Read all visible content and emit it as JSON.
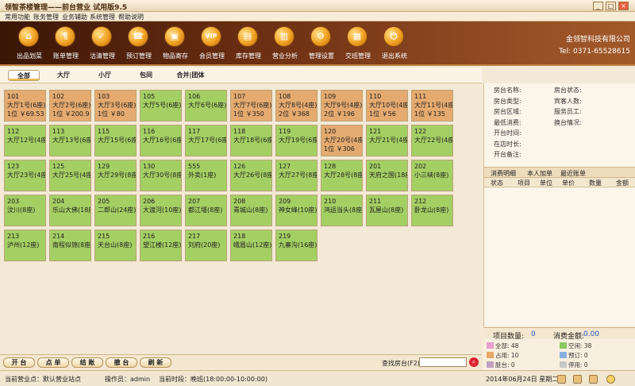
{
  "window": {
    "title": "领智茶楼管理——前台营业 试用版9.5",
    "min": "_",
    "max": "□",
    "close": "×"
  },
  "menu": [
    "常用功能",
    "账务管理",
    "业务辅助",
    "系统管理",
    "帮助说明"
  ],
  "toolbar": [
    {
      "label": "出品划菜",
      "icon": "dish-icon",
      "glyph": "⌂"
    },
    {
      "label": "账单管理",
      "icon": "bill-icon",
      "glyph": "¶"
    },
    {
      "label": "沽清管理",
      "icon": "clear-icon",
      "glyph": "✓"
    },
    {
      "label": "预订管理",
      "icon": "phone-icon",
      "glyph": "☎"
    },
    {
      "label": "物品寄存",
      "icon": "storage-icon",
      "glyph": "▣"
    },
    {
      "label": "会员管理",
      "icon": "vip-icon",
      "glyph": "VIP"
    },
    {
      "label": "库存管理",
      "icon": "folder-icon",
      "glyph": "▤"
    },
    {
      "label": "营业分析",
      "icon": "chart-icon",
      "glyph": "▥"
    },
    {
      "label": "管理设置",
      "icon": "gear-icon",
      "glyph": "⚙"
    },
    {
      "label": "交班管理",
      "icon": "handover-icon",
      "glyph": "▦"
    },
    {
      "label": "退出系统",
      "icon": "power-icon",
      "glyph": "⏻"
    }
  ],
  "company": {
    "name": "金领智科技有限公司",
    "tel": "Tel: 0371-65528615"
  },
  "area_tabs": [
    "全部",
    "大厅",
    "小厅",
    "包间",
    "合并|团体"
  ],
  "rooms": [
    [
      "101",
      "大厅1号(6座)",
      "1位 ￥69.53",
      "busy"
    ],
    [
      "102",
      "大厅2号(6座)",
      "1位 ￥200.9",
      "busy"
    ],
    [
      "103",
      "大厅3号(6座)",
      "1位 ￥80",
      "busy"
    ],
    [
      "105",
      "大厅5号(6座)",
      "",
      "free"
    ],
    [
      "106",
      "大厅6号(6座)",
      "",
      "free"
    ],
    [
      "107",
      "大厅7号(6座)",
      "1位 ￥350",
      "busy"
    ],
    [
      "108",
      "大厅8号(4座)",
      "2位 ￥368",
      "busy"
    ],
    [
      "109",
      "大厅9号(4座)",
      "2位 ￥196",
      "busy"
    ],
    [
      "110",
      "大厅10号(4座)",
      "1位 ￥56",
      "busy"
    ],
    [
      "111",
      "大厅11号(4座)",
      "1位 ￥135",
      "busy"
    ],
    [
      "112",
      "大厅12号(4座)",
      "",
      "free"
    ],
    [
      "113",
      "大厅13号(6座)",
      "",
      "free"
    ],
    [
      "115",
      "大厅15号(6座)",
      "",
      "free"
    ],
    [
      "116",
      "大厅16号(6座)",
      "",
      "free"
    ],
    [
      "117",
      "大厅17号(6座)",
      "",
      "free"
    ],
    [
      "118",
      "大厅18号(6座)",
      "",
      "free"
    ],
    [
      "119",
      "大厅19号(6座)",
      "",
      "free"
    ],
    [
      "120",
      "大厅20号(4座)",
      "1位 ￥306",
      "busy"
    ],
    [
      "121",
      "大厅21号(4座)",
      "",
      "free"
    ],
    [
      "122",
      "大厅22号(4座)",
      "",
      "free"
    ],
    [
      "123",
      "大厅23号(4座)",
      "",
      "free"
    ],
    [
      "125",
      "大厅25号(4座)",
      "",
      "free"
    ],
    [
      "129",
      "大厅29号(8座)",
      "",
      "free"
    ],
    [
      "130",
      "大厅30号(8座)",
      "",
      "free"
    ],
    [
      "555",
      "外卖(1座)",
      "",
      "free"
    ],
    [
      "126",
      "大厅26号(8座)",
      "",
      "free"
    ],
    [
      "127",
      "大厅27号(8座)",
      "",
      "free"
    ],
    [
      "128",
      "大厅28号(8座)",
      "",
      "free"
    ],
    [
      "201",
      "天府之国(18座)",
      "",
      "free"
    ],
    [
      "202",
      "小三峡(8座)",
      "",
      "free"
    ],
    [
      "203",
      "汶川(8座)",
      "",
      "free"
    ],
    [
      "204",
      "乐山大佛(18座)",
      "",
      "free"
    ],
    [
      "205",
      "二郎山(24座)",
      "",
      "free"
    ],
    [
      "206",
      "大渡河(10座)",
      "",
      "free"
    ],
    [
      "207",
      "都江堰(8座)",
      "",
      "free"
    ],
    [
      "208",
      "青城山(8座)",
      "",
      "free"
    ],
    [
      "209",
      "神女峰(10座)",
      "",
      "free"
    ],
    [
      "210",
      "鸿运当头(8座)",
      "",
      "free"
    ],
    [
      "211",
      "瓦屋山(8座)",
      "",
      "free"
    ],
    [
      "212",
      "卧龙山(8座)",
      "",
      "free"
    ],
    [
      "213",
      "泸州(12座)",
      "",
      "free"
    ],
    [
      "214",
      "南程似锦(8座)",
      "",
      "free"
    ],
    [
      "215",
      "天台山(8座)",
      "",
      "free"
    ],
    [
      "216",
      "望江楼(12座)",
      "",
      "free"
    ],
    [
      "217",
      "刘府(20座)",
      "",
      "free"
    ],
    [
      "218",
      "峨眉山(12座)",
      "",
      "free"
    ],
    [
      "219",
      "九寨沟(16座)",
      "",
      "free"
    ]
  ],
  "room_info": {
    "left": [
      "房台名称:",
      "房台类型:",
      "房台区域:",
      "最低消费:",
      "开台时间:",
      "在店时长:",
      "开台备注:"
    ],
    "right": [
      "房台状态:",
      "宾客人数:",
      "服务员工:",
      "换台情况:"
    ]
  },
  "consume_tabs": [
    "消费明细",
    "本人加单",
    "最近账单"
  ],
  "consume_headers": [
    "状态",
    "项目",
    "单位",
    "单价",
    "数量",
    "金额"
  ],
  "summary": {
    "qty_label": "项目数量:",
    "qty": "0",
    "amt_label": "消费金额:",
    "amt": "0.00"
  },
  "legend": [
    {
      "label": "全部: 48",
      "color": "#e8a0d0"
    },
    {
      "label": "空闲: 38",
      "color": "#8cc860"
    },
    {
      "label": "占用: 10",
      "color": "#e8a868"
    },
    {
      "label": "预订: 0",
      "color": "#8ab0e0"
    },
    {
      "label": "脏台: 0",
      "color": "#c0a0c0"
    },
    {
      "label": "停用: 0",
      "color": "#c8c8c8"
    }
  ],
  "buttons": [
    "开 台",
    "点 单",
    "结 账",
    "撤 台",
    "刷 新"
  ],
  "search": {
    "label": "查找房台(F2):",
    "value": ""
  },
  "status": {
    "point": "当前营业点：默认营业站点",
    "operator": "操作员：admin",
    "period": "当前时段：晚班(18:00:00-10:00:00)",
    "date": "2014年06月24日 星期二"
  }
}
